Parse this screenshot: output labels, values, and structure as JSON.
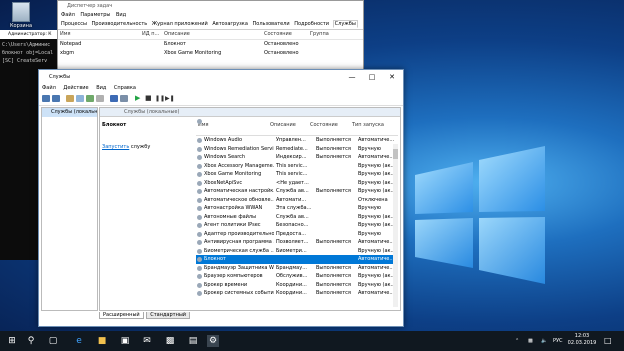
{
  "desktop": {
    "recycle_label": "Корзина"
  },
  "cmd": {
    "title": "Администратор: К",
    "lines": [
      "C:\\Users\\Админис",
      "блокнот obj=Local",
      "[SC] CreateServ"
    ]
  },
  "task_manager": {
    "title": "Диспетчер задач",
    "menu": [
      "Файл",
      "Параметры",
      "Вид"
    ],
    "tabs": [
      "Процессы",
      "Производительность",
      "Журнал приложений",
      "Автозагрузка",
      "Пользователи",
      "Подробности",
      "Службы"
    ],
    "headers": [
      "Имя",
      "ИД п...",
      "Описание",
      "Состояние",
      "Группа"
    ],
    "rows": [
      {
        "name": "Notepad",
        "pid": "",
        "desc": "Блокнот",
        "state": "Остановлено",
        "group": ""
      },
      {
        "name": "xbgm",
        "pid": "",
        "desc": "Xbox Game Monitoring",
        "state": "Остановлено",
        "group": ""
      }
    ]
  },
  "services": {
    "title": "Службы",
    "menu": [
      "Файл",
      "Действие",
      "Вид",
      "Справка"
    ],
    "left_item": "Службы (локальны",
    "bar_label": "Службы (локальные)",
    "selected_name": "Блокнот",
    "start_link": "Запустить",
    "start_suffix": " службу",
    "headers": [
      "Имя",
      "Описание",
      "Состояние",
      "Тип запуска"
    ],
    "rows": [
      [
        "Windows Audio",
        "Управлен...",
        "Выполняется",
        "Автоматиче..."
      ],
      [
        "Windows Remediation Servi...",
        "Remediate...",
        "Выполняется",
        "Вручную"
      ],
      [
        "Windows Search",
        "Индексир...",
        "Выполняется",
        "Автоматиче..."
      ],
      [
        "Xbox Accessory Manageme...",
        "This servic...",
        "",
        "Вручную (ак..."
      ],
      [
        "Xbox Game Monitoring",
        "This servic...",
        "",
        "Вручную (ак..."
      ],
      [
        "XboxNetApiSvc",
        "<Не удает...",
        "",
        "Вручную (ак..."
      ],
      [
        "Автоматическая настройк...",
        "Служба ав...",
        "Выполняется",
        "Вручную (ак..."
      ],
      [
        "Автоматическое обновле...",
        "Автомати...",
        "",
        "Отключена"
      ],
      [
        "Автонастройка WWAN",
        "Эта служба...",
        "",
        "Вручную"
      ],
      [
        "Автономные файлы",
        "Служба ав...",
        "",
        "Вручную (ак..."
      ],
      [
        "Агент политики IPsec",
        "Безопасно...",
        "",
        "Вручную (ак..."
      ],
      [
        "Адаптер производительно...",
        "Предоста...",
        "",
        "Вручную"
      ],
      [
        "Антивирусная программа ...",
        "Позволяет...",
        "Выполняется",
        "Автоматиче..."
      ],
      [
        "Биометрическая служба ...",
        "Биометри...",
        "",
        "Вручную (ак..."
      ],
      [
        "Блокнот",
        "",
        "",
        "Автоматиче..."
      ],
      [
        "Брандмауэр Защитника W...",
        "Брандмау...",
        "Выполняется",
        "Автоматиче..."
      ],
      [
        "Браузер компьютеров",
        "Обслужив...",
        "Выполняется",
        "Вручную (ак..."
      ],
      [
        "Брокер времени",
        "Координи...",
        "Выполняется",
        "Вручную (ак..."
      ],
      [
        "Брокер системных событий",
        "Координи...",
        "Выполняется",
        "Автоматиче..."
      ]
    ],
    "selected_index": 14,
    "tab_extended": "Расширенный",
    "tab_standard": "Стандартный"
  },
  "taskbar": {
    "language": "РУС",
    "time": "12:03",
    "date": "02.03.2019"
  }
}
